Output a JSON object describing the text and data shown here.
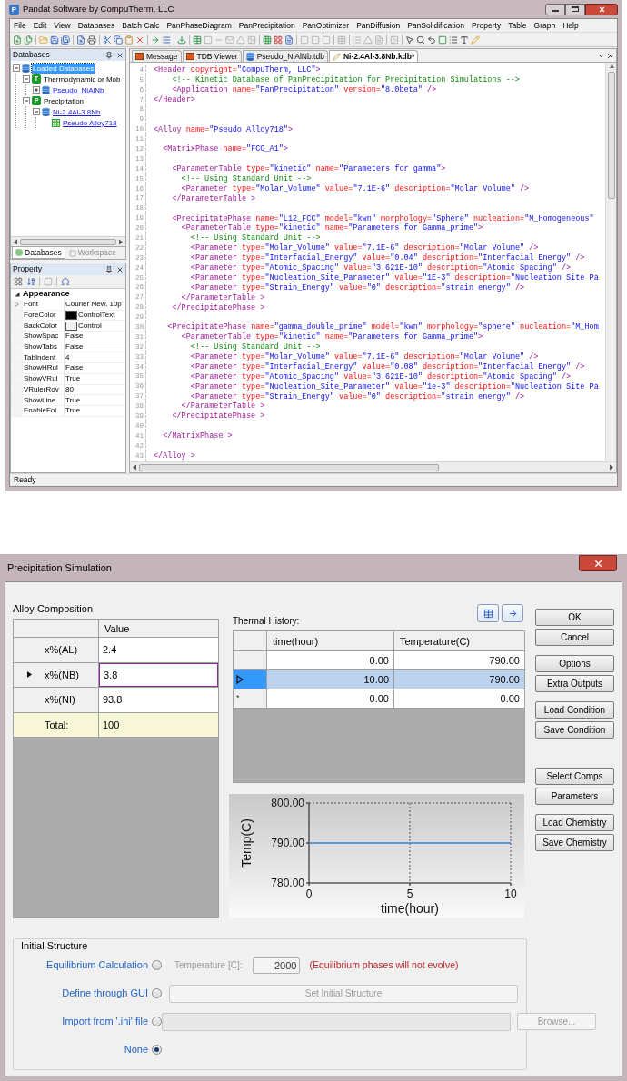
{
  "main_window": {
    "title": "Pandat Software by CompuTherm, LLC",
    "icon_letter": "P",
    "menu": [
      "File",
      "Edit",
      "View",
      "Databases",
      "Batch Calc",
      "PanPhaseDiagram",
      "PanPrecipitation",
      "PanOptimizer",
      "PanDiffusion",
      "PanSolidification",
      "Property",
      "Table",
      "Graph",
      "Help"
    ],
    "status_bar": "Ready"
  },
  "databases_panel": {
    "title": "Databases",
    "tree": [
      {
        "label": "Loaded Databases",
        "kind": "root",
        "expanded": true,
        "selected": true,
        "link": false,
        "children": [
          {
            "label": "Thermodynamic or Mob",
            "kind": "category",
            "badge": "T",
            "expanded": true,
            "selected": false,
            "link": false,
            "children": [
              {
                "label": "Pseudo_NiAlNb",
                "kind": "database",
                "expanded": false,
                "selected": false,
                "link": true
              }
            ]
          },
          {
            "label": "Precipitation",
            "kind": "category",
            "badge": "P",
            "expanded": true,
            "selected": false,
            "link": false,
            "children": [
              {
                "label": "Ni-2.4Al-3.8Nb",
                "kind": "database",
                "expanded": true,
                "selected": false,
                "link": true,
                "children": [
                  {
                    "label": "Pseudo Alloy718",
                    "kind": "alloy",
                    "selected": false,
                    "link": true
                  }
                ]
              }
            ]
          }
        ]
      }
    ],
    "tabs": [
      {
        "label": "Databases",
        "selected": true
      },
      {
        "label": "Workspace",
        "selected": false
      }
    ]
  },
  "property_panel": {
    "title": "Property",
    "category": {
      "label": "Appearance",
      "expanded": true
    },
    "rows": [
      {
        "name": "Font",
        "value": "Courier New, 10p",
        "expandable": true
      },
      {
        "name": "ForeColor",
        "value": "ControlText",
        "expandable": false,
        "color": "#000000"
      },
      {
        "name": "BackColor",
        "value": "Control",
        "expandable": false,
        "color": "#f0f0f0"
      },
      {
        "name": "ShowSpac",
        "value": "False",
        "expandable": false
      },
      {
        "name": "ShowTabs",
        "value": "False",
        "expandable": false
      },
      {
        "name": "TabIndent",
        "value": "4",
        "expandable": false
      },
      {
        "name": "ShowHRul",
        "value": "False",
        "expandable": false
      },
      {
        "name": "ShowVRul",
        "value": "True",
        "expandable": false
      },
      {
        "name": "VRulerRov",
        "value": "80",
        "expandable": false
      },
      {
        "name": "ShowLine",
        "value": "True",
        "expandable": false
      },
      {
        "name": "EnableFol",
        "value": "True",
        "expandable": false
      }
    ]
  },
  "editor": {
    "tabs": [
      {
        "label": "Message",
        "kind": "message",
        "selected": false
      },
      {
        "label": "TDB Viewer",
        "kind": "message",
        "selected": false
      },
      {
        "label": "Pseudo_NiAlNb.tdb",
        "kind": "tdb",
        "selected": false
      },
      {
        "label": "Ni-2.4Al-3.8Nb.kdb*",
        "kind": "kdb",
        "selected": true
      }
    ],
    "lines": [
      {
        "number": "4",
        "segments": [
          {
            "kind": "tag",
            "text": "<Header "
          },
          {
            "kind": "attr",
            "text": "copyright="
          },
          {
            "kind": "value",
            "text": "\"CompuTherm, LLC\""
          },
          {
            "kind": "tag",
            "text": ">"
          }
        ]
      },
      {
        "number": "5",
        "segments": [
          {
            "kind": "comment",
            "text": "    <!-- Kinetic Database of PanPrecipitation for Precipitation Simulations -->"
          }
        ]
      },
      {
        "number": "6",
        "segments": [
          {
            "kind": "tag",
            "text": "    <Application "
          },
          {
            "kind": "attr",
            "text": "name="
          },
          {
            "kind": "value",
            "text": "\"PanPrecipitation\""
          },
          {
            "kind": "attr",
            "text": " version="
          },
          {
            "kind": "value",
            "text": "\"8.0beta\""
          },
          {
            "kind": "tag",
            "text": " />"
          }
        ]
      },
      {
        "number": "7",
        "segments": [
          {
            "kind": "tag",
            "text": "</Header>"
          }
        ]
      },
      {
        "number": "8"
      },
      {
        "number": "9"
      },
      {
        "number": "10",
        "segments": [
          {
            "kind": "tag",
            "text": "<Alloy "
          },
          {
            "kind": "attr",
            "text": "name="
          },
          {
            "kind": "value",
            "text": "\"Pseudo Alloy718\""
          },
          {
            "kind": "tag",
            "text": ">"
          }
        ]
      },
      {
        "number": "11"
      },
      {
        "number": "12",
        "segments": [
          {
            "kind": "tag",
            "text": "  <MatrixPhase "
          },
          {
            "kind": "attr",
            "text": "name="
          },
          {
            "kind": "value",
            "text": "\"FCC_A1\""
          },
          {
            "kind": "tag",
            "text": ">"
          }
        ]
      },
      {
        "number": "13"
      },
      {
        "number": "14",
        "segments": [
          {
            "kind": "tag",
            "text": "    <ParameterTable "
          },
          {
            "kind": "attr",
            "text": "type="
          },
          {
            "kind": "value",
            "text": "\"kinetic\""
          },
          {
            "kind": "attr",
            "text": " name="
          },
          {
            "kind": "value",
            "text": "\"Parameters for gamma\""
          },
          {
            "kind": "tag",
            "text": ">"
          }
        ]
      },
      {
        "number": "15",
        "segments": [
          {
            "kind": "comment",
            "text": "      <!-- Using Standard Unit -->"
          }
        ]
      },
      {
        "number": "16",
        "segments": [
          {
            "kind": "tag",
            "text": "      <Parameter "
          },
          {
            "kind": "attr",
            "text": "type="
          },
          {
            "kind": "value",
            "text": "\"Molar_Volume\""
          },
          {
            "kind": "attr",
            "text": " value="
          },
          {
            "kind": "value",
            "text": "\"7.1E-6\""
          },
          {
            "kind": "attr",
            "text": " description="
          },
          {
            "kind": "value",
            "text": "\"Molar Volume\""
          },
          {
            "kind": "tag",
            "text": " />"
          }
        ]
      },
      {
        "number": "17",
        "segments": [
          {
            "kind": "tag",
            "text": "    </ParameterTable >"
          }
        ]
      },
      {
        "number": "18"
      },
      {
        "number": "19",
        "segments": [
          {
            "kind": "tag",
            "text": "    <PrecipitatePhase "
          },
          {
            "kind": "attr",
            "text": "name="
          },
          {
            "kind": "value",
            "text": "\"L12_FCC\""
          },
          {
            "kind": "attr",
            "text": " model="
          },
          {
            "kind": "value",
            "text": "\"kwn\""
          },
          {
            "kind": "attr",
            "text": " morphology="
          },
          {
            "kind": "value",
            "text": "\"Sphere\""
          },
          {
            "kind": "attr",
            "text": " nucleation="
          },
          {
            "kind": "value",
            "text": "\"M_Homogeneous\""
          }
        ]
      },
      {
        "number": "20",
        "segments": [
          {
            "kind": "tag",
            "text": "      <ParameterTable "
          },
          {
            "kind": "attr",
            "text": "type="
          },
          {
            "kind": "value",
            "text": "\"kinetic\""
          },
          {
            "kind": "attr",
            "text": " name="
          },
          {
            "kind": "value",
            "text": "\"Parameters for Gamma_prime\""
          },
          {
            "kind": "tag",
            "text": ">"
          }
        ]
      },
      {
        "number": "21",
        "segments": [
          {
            "kind": "comment",
            "text": "        <!-- Using Standard Unit -->"
          }
        ]
      },
      {
        "number": "22",
        "segments": [
          {
            "kind": "tag",
            "text": "        <Parameter "
          },
          {
            "kind": "attr",
            "text": "type="
          },
          {
            "kind": "value",
            "text": "\"Molar_Volume\""
          },
          {
            "kind": "attr",
            "text": " value="
          },
          {
            "kind": "value",
            "text": "\"7.1E-6\""
          },
          {
            "kind": "attr",
            "text": " description="
          },
          {
            "kind": "value",
            "text": "\"Molar Volume\""
          },
          {
            "kind": "tag",
            "text": " />"
          }
        ]
      },
      {
        "number": "23",
        "segments": [
          {
            "kind": "tag",
            "text": "        <Parameter "
          },
          {
            "kind": "attr",
            "text": "type="
          },
          {
            "kind": "value",
            "text": "\"Interfacial_Energy\""
          },
          {
            "kind": "attr",
            "text": " value="
          },
          {
            "kind": "value",
            "text": "\"0.04\""
          },
          {
            "kind": "attr",
            "text": " description="
          },
          {
            "kind": "value",
            "text": "\"Interfacial Energy\""
          },
          {
            "kind": "tag",
            "text": " />"
          }
        ]
      },
      {
        "number": "24",
        "segments": [
          {
            "kind": "tag",
            "text": "        <Parameter "
          },
          {
            "kind": "attr",
            "text": "type="
          },
          {
            "kind": "value",
            "text": "\"Atomic_Spacing\""
          },
          {
            "kind": "attr",
            "text": " value="
          },
          {
            "kind": "value",
            "text": "\"3.621E-10\""
          },
          {
            "kind": "attr",
            "text": " description="
          },
          {
            "kind": "value",
            "text": "\"Atomic Spacing\""
          },
          {
            "kind": "tag",
            "text": " />"
          }
        ]
      },
      {
        "number": "25",
        "segments": [
          {
            "kind": "tag",
            "text": "        <Parameter "
          },
          {
            "kind": "attr",
            "text": "type="
          },
          {
            "kind": "value",
            "text": "\"Nucleation_Site_Parameter\""
          },
          {
            "kind": "attr",
            "text": " value="
          },
          {
            "kind": "value",
            "text": "\"1E-3\""
          },
          {
            "kind": "attr",
            "text": " description="
          },
          {
            "kind": "value",
            "text": "\"Nucleation Site Pa"
          }
        ]
      },
      {
        "number": "26",
        "segments": [
          {
            "kind": "tag",
            "text": "        <Parameter "
          },
          {
            "kind": "attr",
            "text": "type="
          },
          {
            "kind": "value",
            "text": "\"Strain_Energy\""
          },
          {
            "kind": "attr",
            "text": " value="
          },
          {
            "kind": "value",
            "text": "\"0\""
          },
          {
            "kind": "attr",
            "text": " description="
          },
          {
            "kind": "value",
            "text": "\"strain energy\""
          },
          {
            "kind": "tag",
            "text": " />"
          }
        ]
      },
      {
        "number": "27",
        "segments": [
          {
            "kind": "tag",
            "text": "      </ParameterTable >"
          }
        ]
      },
      {
        "number": "28",
        "segments": [
          {
            "kind": "tag",
            "text": "    </PrecipitatePhase >"
          }
        ]
      },
      {
        "number": "29"
      },
      {
        "number": "30",
        "segments": [
          {
            "kind": "tag",
            "text": "   <PrecipitatePhase "
          },
          {
            "kind": "attr",
            "text": "name="
          },
          {
            "kind": "value",
            "text": "\"gamma_double_prime\""
          },
          {
            "kind": "attr",
            "text": " model="
          },
          {
            "kind": "value",
            "text": "\"kwn\""
          },
          {
            "kind": "attr",
            "text": " morphology="
          },
          {
            "kind": "value",
            "text": "\"sphere\""
          },
          {
            "kind": "attr",
            "text": " nucleation="
          },
          {
            "kind": "value",
            "text": "\"M_Hom"
          }
        ]
      },
      {
        "number": "31",
        "segments": [
          {
            "kind": "tag",
            "text": "      <ParameterTable "
          },
          {
            "kind": "attr",
            "text": "type="
          },
          {
            "kind": "value",
            "text": "\"kinetic\""
          },
          {
            "kind": "attr",
            "text": " name="
          },
          {
            "kind": "value",
            "text": "\"Parameters for Gamma_prime\""
          },
          {
            "kind": "tag",
            "text": ">"
          }
        ]
      },
      {
        "number": "32",
        "segments": [
          {
            "kind": "comment",
            "text": "        <!-- Using Standard Unit -->"
          }
        ]
      },
      {
        "number": "33",
        "segments": [
          {
            "kind": "tag",
            "text": "        <Parameter "
          },
          {
            "kind": "attr",
            "text": "type="
          },
          {
            "kind": "value",
            "text": "\"Molar_Volume\""
          },
          {
            "kind": "attr",
            "text": " value="
          },
          {
            "kind": "value",
            "text": "\"7.1E-6\""
          },
          {
            "kind": "attr",
            "text": " description="
          },
          {
            "kind": "value",
            "text": "\"Molar Volume\""
          },
          {
            "kind": "tag",
            "text": " />"
          }
        ]
      },
      {
        "number": "34",
        "segments": [
          {
            "kind": "tag",
            "text": "        <Parameter "
          },
          {
            "kind": "attr",
            "text": "type="
          },
          {
            "kind": "value",
            "text": "\"Interfacial_Energy\""
          },
          {
            "kind": "attr",
            "text": " value="
          },
          {
            "kind": "value",
            "text": "\"0.08\""
          },
          {
            "kind": "attr",
            "text": " description="
          },
          {
            "kind": "value",
            "text": "\"Interfacial Energy\""
          },
          {
            "kind": "tag",
            "text": " />"
          }
        ]
      },
      {
        "number": "35",
        "segments": [
          {
            "kind": "tag",
            "text": "        <Parameter "
          },
          {
            "kind": "attr",
            "text": "type="
          },
          {
            "kind": "value",
            "text": "\"Atomic_Spacing\""
          },
          {
            "kind": "attr",
            "text": " value="
          },
          {
            "kind": "value",
            "text": "\"3.621E-10\""
          },
          {
            "kind": "attr",
            "text": " description="
          },
          {
            "kind": "value",
            "text": "\"Atomic Spacing\""
          },
          {
            "kind": "tag",
            "text": " />"
          }
        ]
      },
      {
        "number": "36",
        "segments": [
          {
            "kind": "tag",
            "text": "        <Parameter "
          },
          {
            "kind": "attr",
            "text": "type="
          },
          {
            "kind": "value",
            "text": "\"Nucleation_Site_Parameter\""
          },
          {
            "kind": "attr",
            "text": " value="
          },
          {
            "kind": "value",
            "text": "\"1e-3\""
          },
          {
            "kind": "attr",
            "text": " description="
          },
          {
            "kind": "value",
            "text": "\"Nucleation Site Pa"
          }
        ]
      },
      {
        "number": "37",
        "segments": [
          {
            "kind": "tag",
            "text": "        <Parameter "
          },
          {
            "kind": "attr",
            "text": "type="
          },
          {
            "kind": "value",
            "text": "\"Strain_Energy\""
          },
          {
            "kind": "attr",
            "text": " value="
          },
          {
            "kind": "value",
            "text": "\"0\""
          },
          {
            "kind": "attr",
            "text": " description="
          },
          {
            "kind": "value",
            "text": "\"strain energy\""
          },
          {
            "kind": "tag",
            "text": " />"
          }
        ]
      },
      {
        "number": "38",
        "segments": [
          {
            "kind": "tag",
            "text": "      </ParameterTable >"
          }
        ]
      },
      {
        "number": "39",
        "segments": [
          {
            "kind": "tag",
            "text": "    </PrecipitatePhase >"
          }
        ]
      },
      {
        "number": "40"
      },
      {
        "number": "41",
        "segments": [
          {
            "kind": "tag",
            "text": "  </MatrixPhase >"
          }
        ]
      },
      {
        "number": "42"
      },
      {
        "number": "43",
        "segments": [
          {
            "kind": "tag",
            "text": "</Alloy >"
          }
        ]
      }
    ]
  },
  "dialog": {
    "title": "Precipitation Simulation",
    "alloy_composition": {
      "title": "Alloy Composition",
      "columns": [
        "Value"
      ],
      "rows": [
        {
          "label": "x%(AL)",
          "value": "2.4",
          "kind": "element",
          "selected": false
        },
        {
          "label": "x%(NB)",
          "value": "3.8",
          "kind": "element",
          "selected": true
        },
        {
          "label": "x%(NI)",
          "value": "93.8",
          "kind": "element",
          "selected": false
        },
        {
          "label": "Total:",
          "value": "100",
          "kind": "total",
          "selected": false
        }
      ]
    },
    "thermal_history": {
      "title": "Thermal History:",
      "columns": [
        "time(hour)",
        "Temperature(C)"
      ],
      "rows": [
        {
          "cells": [
            "0.00",
            "790.00"
          ],
          "kind": "data",
          "selected": false
        },
        {
          "cells": [
            "10.00",
            "790.00"
          ],
          "kind": "data",
          "selected": true
        },
        {
          "marker": "*",
          "cells": [
            "0.00",
            "0.00"
          ],
          "kind": "new",
          "selected": false
        }
      ],
      "chart_data": {
        "type": "line",
        "xlabel": "time(hour)",
        "ylabel": "Temp(C)",
        "x": [
          0,
          10
        ],
        "series": [
          {
            "color": "#3a7fd8",
            "values": [
              790,
              790
            ]
          }
        ],
        "xlim": [
          0,
          10
        ],
        "ylim": [
          780,
          800
        ],
        "xticks": [
          0,
          5,
          10
        ],
        "yticks": [
          {
            "value": 780,
            "label": "780.00"
          },
          {
            "value": 790,
            "label": "790.00"
          },
          {
            "value": 800,
            "label": "800.00"
          }
        ]
      }
    },
    "button_groups": [
      [
        "OK",
        "Cancel"
      ],
      [
        "Options",
        "Extra Outputs"
      ],
      [
        "Load Condition",
        "Save Condition"
      ],
      [
        "Select Comps",
        "Parameters"
      ],
      [
        "Load Chemistry",
        "Save Chemistry"
      ]
    ],
    "initial_structure": {
      "title": "Initial Structure",
      "options": [
        {
          "label": "Equilibrium Calculation",
          "kind": "temperature",
          "selected": false,
          "field_label": "Temperature [C]:",
          "value": "2000",
          "disabled": true,
          "note": "(Equilibrium phases will not evolve)"
        },
        {
          "label": "Define through GUI",
          "kind": "button",
          "selected": false,
          "button": "Set Initial Structure",
          "disabled": true
        },
        {
          "label": "Import from '.ini' file",
          "kind": "file",
          "selected": false,
          "button": "Browse...",
          "disabled": true
        },
        {
          "label": "None",
          "kind": "none",
          "selected": true
        }
      ]
    }
  }
}
